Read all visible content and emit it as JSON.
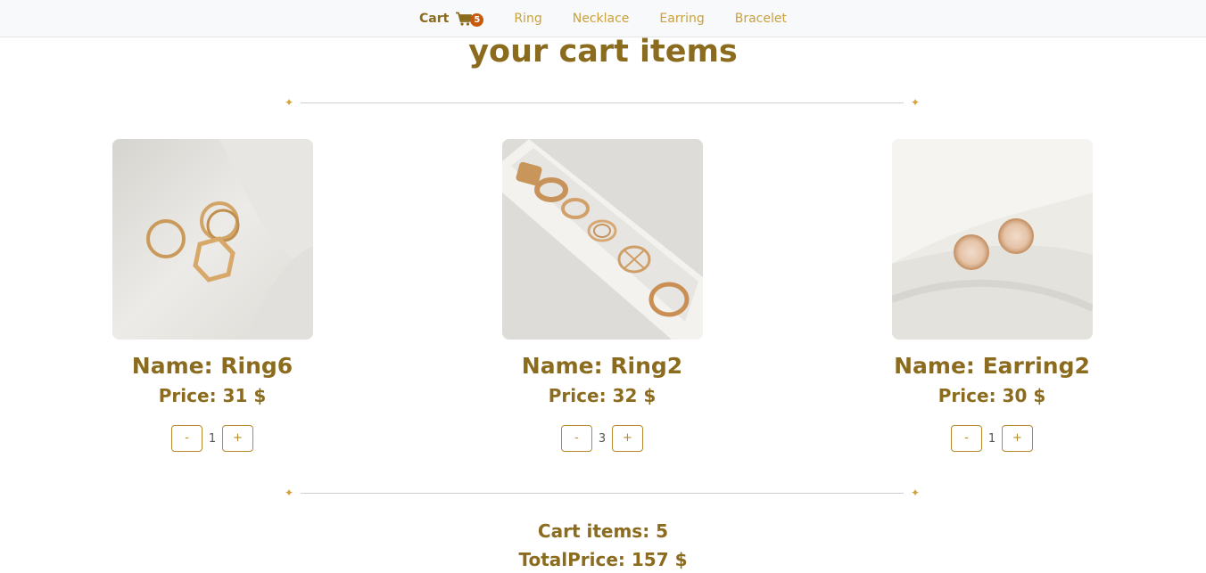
{
  "nav": {
    "cart_label": "Cart",
    "cart_count": "5",
    "links": [
      "Ring",
      "Necklace",
      "Earring",
      "Bracelet"
    ]
  },
  "page": {
    "title": "your cart items"
  },
  "divider": {
    "glyph": "✦"
  },
  "items": [
    {
      "name": "Name: Ring6",
      "price": "Price: 31 $",
      "minus": "-",
      "qty": "1",
      "plus": "+",
      "image": "gold-rings-on-fabric"
    },
    {
      "name": "Name: Ring2",
      "price": "Price: 32 $",
      "minus": "-",
      "qty": "3",
      "plus": "+",
      "image": "gold-rings-in-tray"
    },
    {
      "name": "Name: Earring2",
      "price": "Price: 30 $",
      "minus": "-",
      "qty": "1",
      "plus": "+",
      "image": "gold-stud-earrings"
    }
  ],
  "summary": {
    "cart_items": "Cart items: 5",
    "total_price": "TotalPrice: 157 $"
  },
  "colors": {
    "accent": "#8b6b1e",
    "link": "#c9a13e",
    "badge": "#c8580b"
  }
}
